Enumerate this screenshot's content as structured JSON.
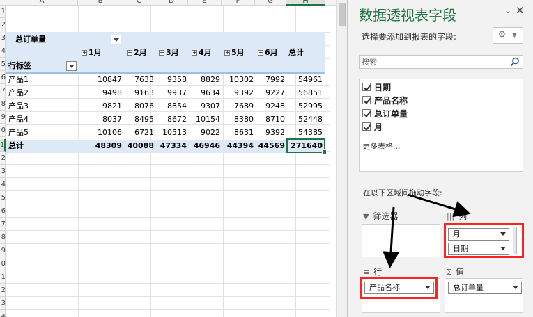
{
  "sheet": {
    "column_headers": [
      "A",
      "B",
      "C",
      "D",
      "E",
      "F",
      "G",
      "H"
    ],
    "row_headers": [
      "1",
      "2",
      "3",
      "4",
      "5",
      "6",
      "7",
      "8",
      "9",
      "0",
      "1",
      "2",
      "3",
      "4",
      "5",
      "6",
      "7",
      "8",
      "9",
      "0",
      "1",
      "2",
      "3",
      "4"
    ],
    "pivot": {
      "value_field": "总订单量",
      "row_label": "行标签",
      "month_headers": [
        "1月",
        "2月",
        "3月",
        "4月",
        "5月",
        "6月"
      ],
      "total_header": "总计",
      "rows": [
        {
          "label": "产品1",
          "values": [
            "10847",
            "7633",
            "9358",
            "8829",
            "10302",
            "7992",
            "54961"
          ]
        },
        {
          "label": "产品2",
          "values": [
            "9498",
            "9163",
            "9937",
            "9634",
            "9392",
            "9227",
            "56851"
          ]
        },
        {
          "label": "产品3",
          "values": [
            "9821",
            "8076",
            "8854",
            "9307",
            "7689",
            "9248",
            "52995"
          ]
        },
        {
          "label": "产品4",
          "values": [
            "8037",
            "8495",
            "8672",
            "10154",
            "8380",
            "8710",
            "52448"
          ]
        },
        {
          "label": "产品5",
          "values": [
            "10106",
            "6721",
            "10513",
            "9022",
            "8631",
            "9392",
            "54385"
          ]
        }
      ],
      "grand_total": {
        "label": "总计",
        "values": [
          "48309",
          "40088",
          "47334",
          "46946",
          "44394",
          "44569",
          "271640"
        ]
      }
    }
  },
  "pane": {
    "title": "数据透视表字段",
    "subtitle": "选择要添加到报表的字段:",
    "search_placeholder": "搜索",
    "fields": [
      "日期",
      "产品名称",
      "总订单量",
      "月"
    ],
    "more_tables": "更多表格...",
    "drag_hint": "在以下区域间拖动字段:",
    "areas": {
      "filters": {
        "label": "筛选器"
      },
      "columns": {
        "label": "列",
        "items": [
          "月",
          "日期"
        ]
      },
      "rows": {
        "label": "行",
        "items": [
          "产品名称"
        ]
      },
      "values": {
        "label": "值",
        "items": [
          "总订单量"
        ]
      }
    },
    "icons": {
      "gear": "gear-icon",
      "close": "close-icon",
      "dropdown": "chevron-down-icon",
      "search": "search-icon"
    }
  },
  "colors": {
    "excel_green": "#217346",
    "pivot_band": "#dde9f6",
    "highlight_red": "#ff2222"
  }
}
